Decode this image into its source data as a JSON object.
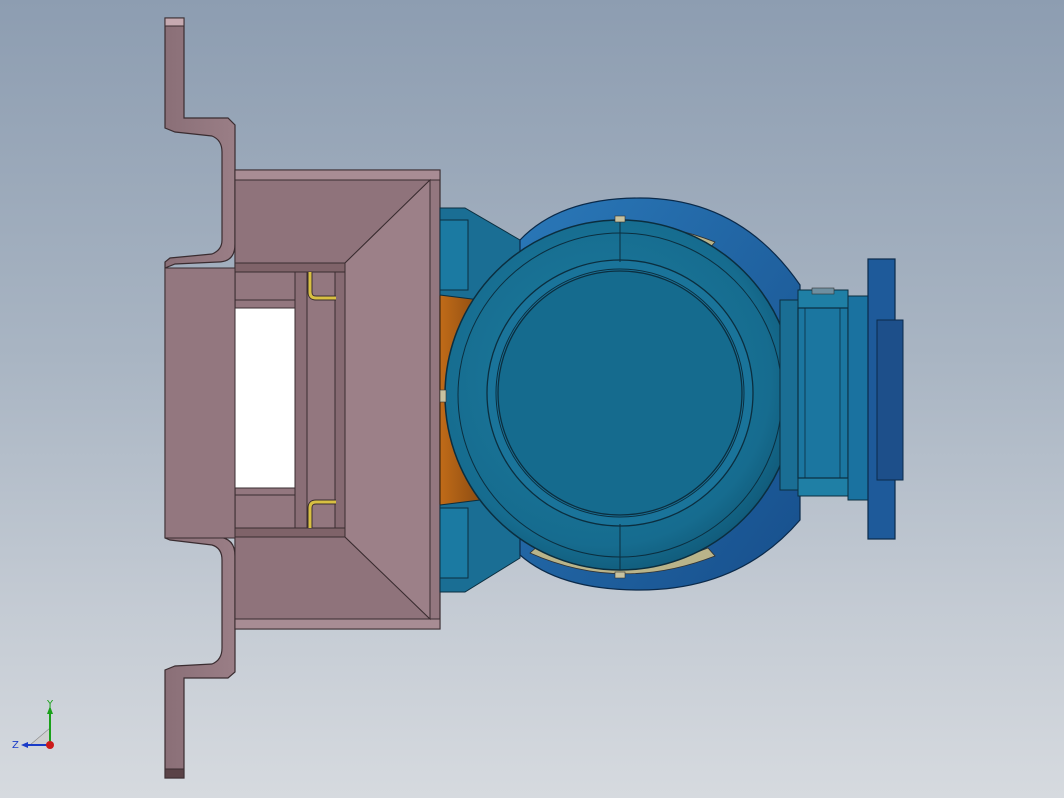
{
  "viewport": {
    "background_top": "#8d9db1",
    "background_bottom": "#d6dadf"
  },
  "colors": {
    "frame_fill": "#93777f",
    "frame_dark": "#6e5359",
    "frame_light": "#b89aa2",
    "frame_outline": "#3a2c30",
    "pump_blue": "#1f7fa0",
    "pump_blue_dark": "#13607d",
    "pump_blue_light": "#3aa0c4",
    "flange_blue": "#1e5a9a",
    "copper": "#b5651d",
    "yellow_bracket": "#d2b532",
    "opening": "#ffffff"
  },
  "triad": {
    "y_label": "Y",
    "z_label": "Z",
    "y_color": "#1aa01a",
    "z_color": "#1a3cc8",
    "x_color": "#cc1a1a"
  },
  "parts": {
    "base_frame": "base-frame",
    "motor_housing": "motor-housing",
    "gearbox": "gearbox",
    "output_flange": "output-flange"
  }
}
